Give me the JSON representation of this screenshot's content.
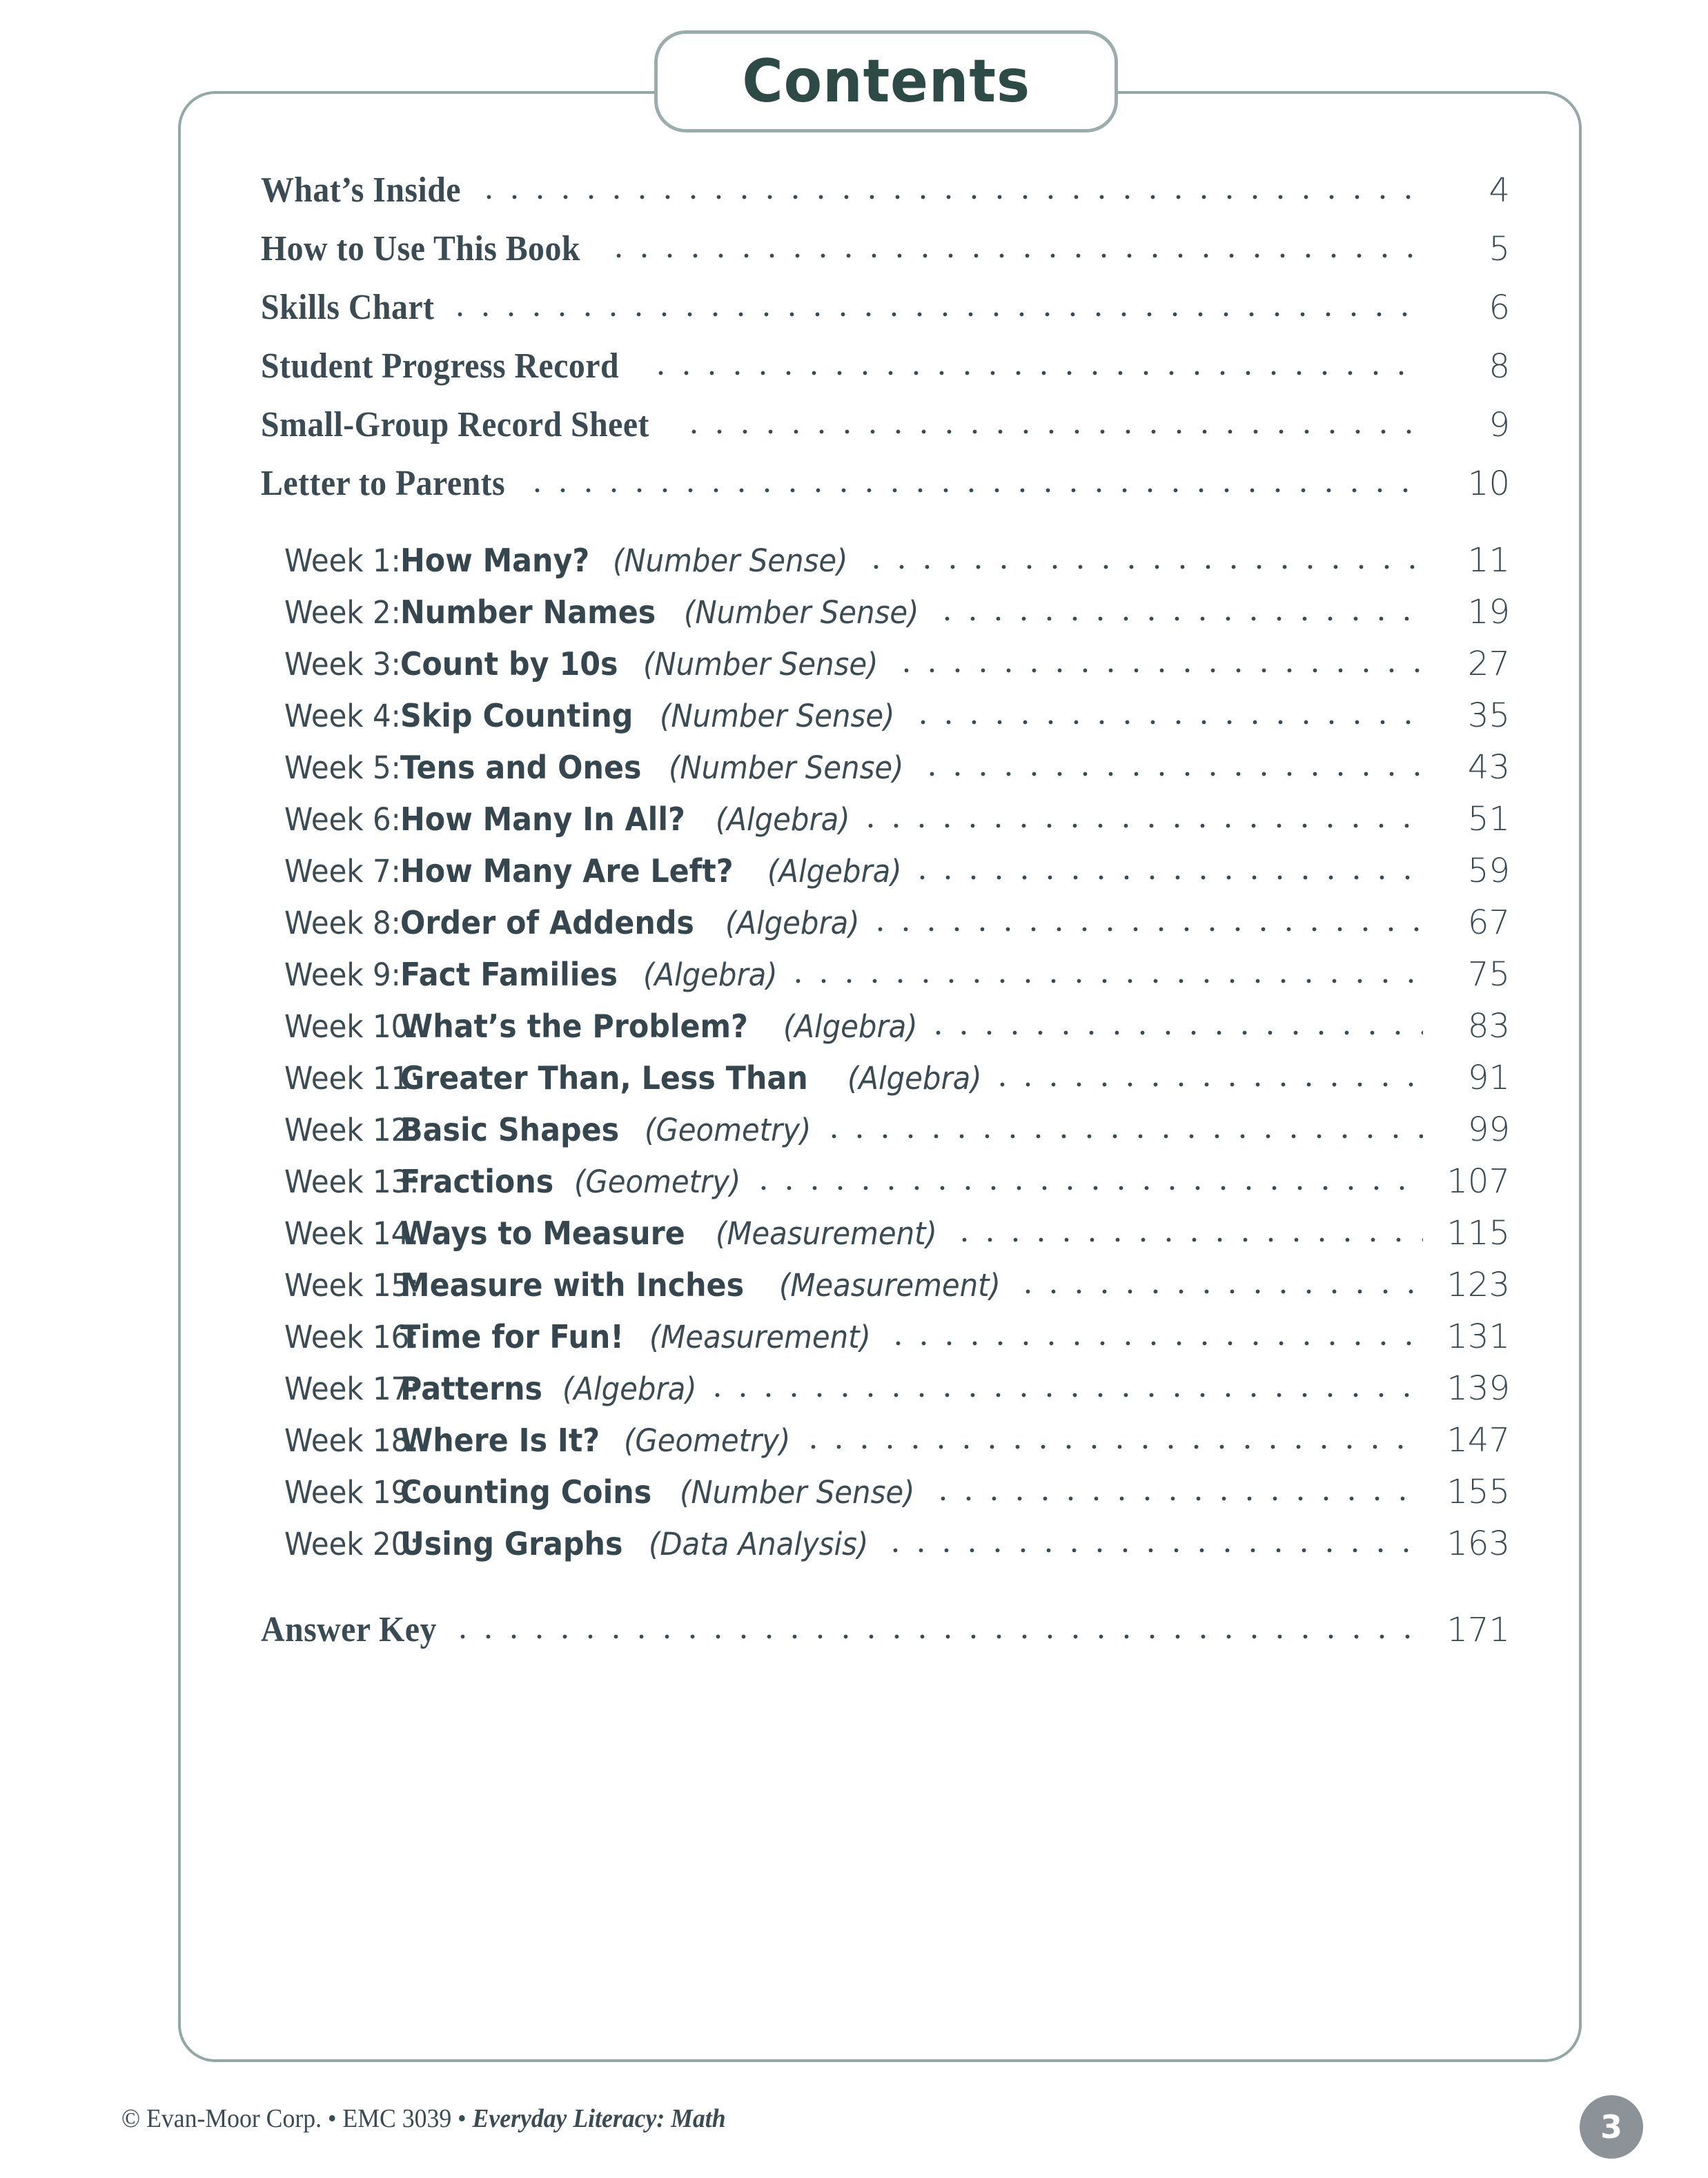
{
  "page": {
    "title": "Contents",
    "background_color": "#ffffff",
    "text_color": "#3b4b54",
    "frame_border_color": "#93a7a4",
    "badge_border_color": "#9aadaa",
    "title_color": "#2d4a47"
  },
  "front_matter": [
    {
      "label": "What’s Inside",
      "page": "4"
    },
    {
      "label": "How to Use This Book",
      "page": "5"
    },
    {
      "label": "Skills Chart",
      "page": "6"
    },
    {
      "label": "Student Progress Record",
      "page": "8"
    },
    {
      "label": "Small-Group Record Sheet",
      "page": "9"
    },
    {
      "label": "Letter to Parents",
      "page": "10"
    }
  ],
  "weeks": [
    {
      "week": "Week 1:",
      "title": "How Many?",
      "category": "(Number Sense)",
      "page": "11"
    },
    {
      "week": "Week 2:",
      "title": "Number Names",
      "category": "(Number Sense)",
      "page": "19"
    },
    {
      "week": "Week 3:",
      "title": "Count by 10s",
      "category": "(Number Sense)",
      "page": "27"
    },
    {
      "week": "Week 4:",
      "title": "Skip Counting",
      "category": "(Number Sense)",
      "page": "35"
    },
    {
      "week": "Week 5:",
      "title": "Tens and Ones",
      "category": "(Number Sense)",
      "page": "43"
    },
    {
      "week": "Week 6:",
      "title": "How Many In All?",
      "category": "(Algebra)",
      "page": "51"
    },
    {
      "week": "Week 7:",
      "title": "How Many Are Left?",
      "category": "(Algebra)",
      "page": "59"
    },
    {
      "week": "Week 8:",
      "title": "Order of Addends",
      "category": "(Algebra)",
      "page": "67"
    },
    {
      "week": "Week 9:",
      "title": "Fact Families",
      "category": "(Algebra)",
      "page": "75"
    },
    {
      "week": "Week 10:",
      "title": "What’s the Problem?",
      "category": "(Algebra)",
      "page": "83"
    },
    {
      "week": "Week 11:",
      "title": "Greater Than, Less Than",
      "category": "(Algebra)",
      "page": "91"
    },
    {
      "week": "Week 12:",
      "title": "Basic Shapes",
      "category": "(Geometry)",
      "page": "99"
    },
    {
      "week": "Week 13:",
      "title": "Fractions",
      "category": "(Geometry)",
      "page": "107"
    },
    {
      "week": "Week 14:",
      "title": "Ways to Measure",
      "category": "(Measurement)",
      "page": "115"
    },
    {
      "week": "Week 15:",
      "title": "Measure with Inches",
      "category": "(Measurement)",
      "page": "123"
    },
    {
      "week": "Week 16:",
      "title": "Time for Fun!",
      "category": "(Measurement)",
      "page": "131"
    },
    {
      "week": "Week 17:",
      "title": "Patterns",
      "category": "(Algebra)",
      "page": "139"
    },
    {
      "week": "Week 18:",
      "title": "Where Is It?",
      "category": "(Geometry)",
      "page": "147"
    },
    {
      "week": "Week 19:",
      "title": "Counting Coins",
      "category": "(Number Sense)",
      "page": "155"
    },
    {
      "week": "Week 20:",
      "title": "Using Graphs",
      "category": "(Data Analysis)",
      "page": "163"
    }
  ],
  "answer_key": {
    "label": "Answer Key",
    "page": "171"
  },
  "footer": {
    "copyright": "© Evan-Moor Corp. • EMC 3039 • ",
    "book_title": "Everyday Literacy: Math",
    "page_number": "3",
    "page_number_badge_color": "#8b9398"
  }
}
